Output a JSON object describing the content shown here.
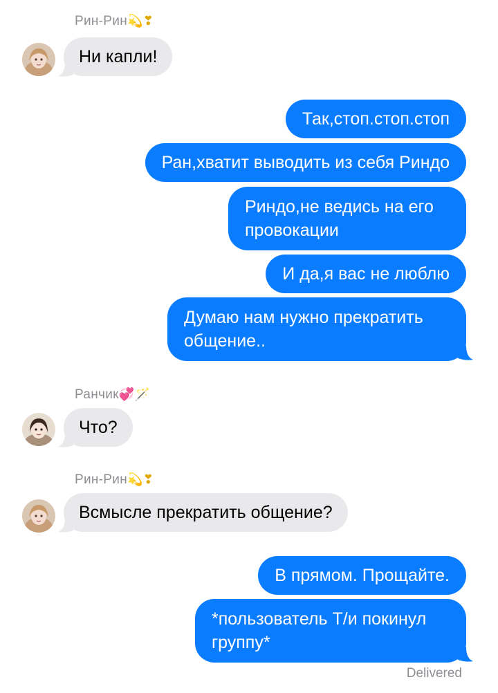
{
  "conversation": {
    "messages": [
      {
        "direction": "in",
        "sender": "Рин-Рин",
        "sender_emoji": "💫❣",
        "text": "Ни капли!"
      },
      {
        "direction": "out",
        "text": "Так,стоп.стоп.стоп"
      },
      {
        "direction": "out",
        "text": "Ран,хватит выводить из себя Риндо"
      },
      {
        "direction": "out",
        "text": "Риндо,не ведись на его провокации"
      },
      {
        "direction": "out",
        "text": "И да,я вас не люблю"
      },
      {
        "direction": "out",
        "text": "Думаю нам нужно прекратить общение.."
      },
      {
        "direction": "in",
        "sender": "Ранчик",
        "sender_emoji": "💞🪄",
        "text": "Что?"
      },
      {
        "direction": "in",
        "sender": "Рин-Рин",
        "sender_emoji": "💫❣",
        "text": "Всмысле прекратить общение?"
      },
      {
        "direction": "out",
        "text": "В прямом. Прощайте."
      },
      {
        "direction": "out",
        "text": "*пользователь Т/и покинул группу*"
      }
    ],
    "status": "Delivered"
  },
  "colors": {
    "outgoing_bubble": "#0a7cff",
    "incoming_bubble": "#e9e9eb",
    "meta_text": "#8e8e93"
  }
}
